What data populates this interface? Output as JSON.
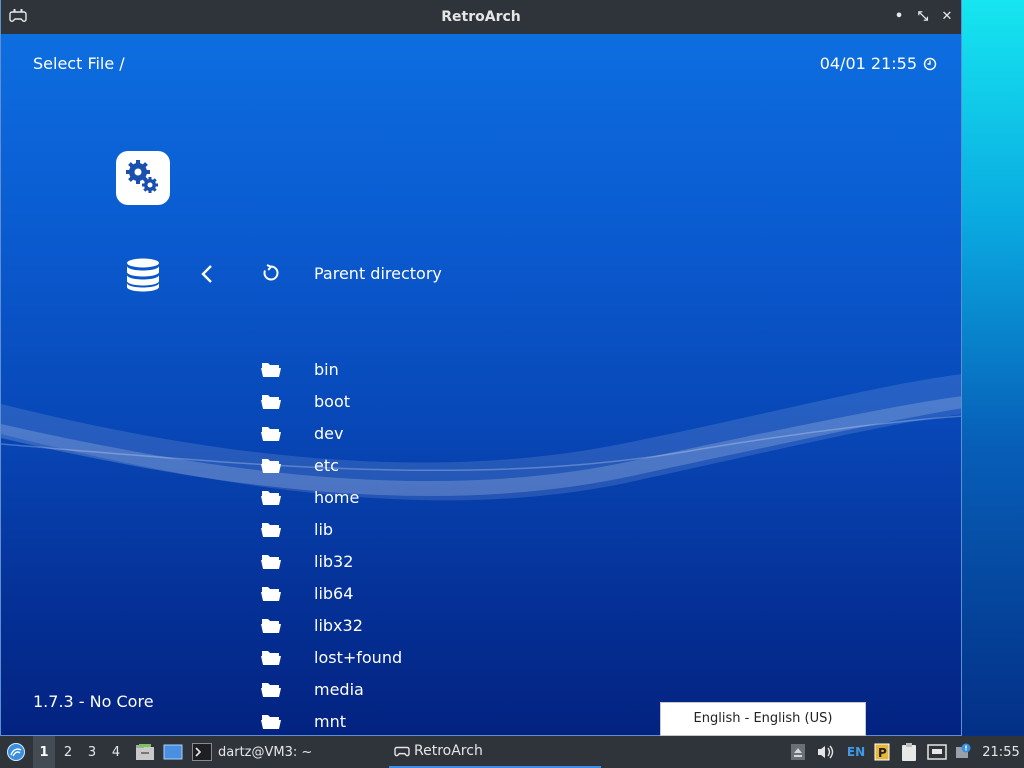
{
  "window": {
    "title": "RetroArch",
    "controls": {
      "minimize": "•",
      "restore": "⤡",
      "close": "✕"
    }
  },
  "header": {
    "location": "Select File /",
    "datetime": "04/01 21:55"
  },
  "sidebar": {
    "settings_icon": "gears-icon",
    "database_icon": "database-icon",
    "back_icon": "chevron-left-icon"
  },
  "parent": {
    "label": "Parent directory",
    "icon": "refresh-icon"
  },
  "folders": [
    "bin",
    "boot",
    "dev",
    "etc",
    "home",
    "lib",
    "lib32",
    "lib64",
    "libx32",
    "lost+found",
    "media",
    "mnt"
  ],
  "footer": {
    "version": "1.7.3 - No Core"
  },
  "tooltip": {
    "text": "English - English (US)"
  },
  "taskbar": {
    "workspaces": [
      "1",
      "2",
      "3",
      "4"
    ],
    "terminal_label": "dartz@VM3: ~",
    "app_label": "RetroArch",
    "lang": "EN",
    "clock": "21:55"
  },
  "colors": {
    "accent_blue": "#0a5bd0",
    "titlebar": "#2f343b",
    "icon_white": "#ffffff"
  }
}
